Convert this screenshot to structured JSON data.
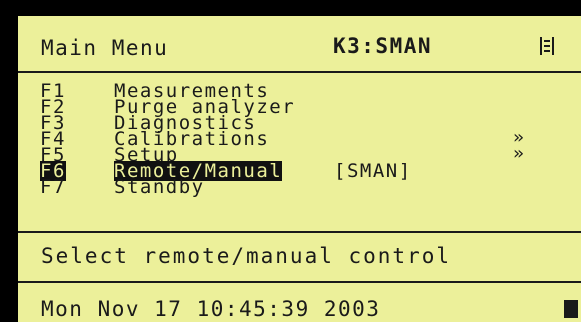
{
  "header": {
    "title": "Main Menu",
    "mode": "K3:SMAN",
    "menu_icon": "list-icon"
  },
  "menu": {
    "items": [
      {
        "key": "F1",
        "label": "Measurements",
        "arrow": ""
      },
      {
        "key": "F2",
        "label": "Purge analyzer",
        "arrow": ""
      },
      {
        "key": "F3",
        "label": "Diagnostics",
        "arrow": ""
      },
      {
        "key": "F4",
        "label": "Calibrations",
        "arrow": "»"
      },
      {
        "key": "F5",
        "label": "Setup",
        "arrow": "»"
      },
      {
        "key": "F6",
        "label": "Remote/Manual",
        "arrow": "",
        "badge": "[SMAN]",
        "selected": true
      },
      {
        "key": "F7",
        "label": "Standby",
        "arrow": ""
      }
    ]
  },
  "help": {
    "text": "Select remote/manual control"
  },
  "footer": {
    "datetime": "Mon Nov 17 10:45:39 2003",
    "status_icon": "block-cursor-icon"
  },
  "colors": {
    "lcd_background": "#ecf09a",
    "lcd_text": "#1a1a1a",
    "bezel": "#000000"
  }
}
